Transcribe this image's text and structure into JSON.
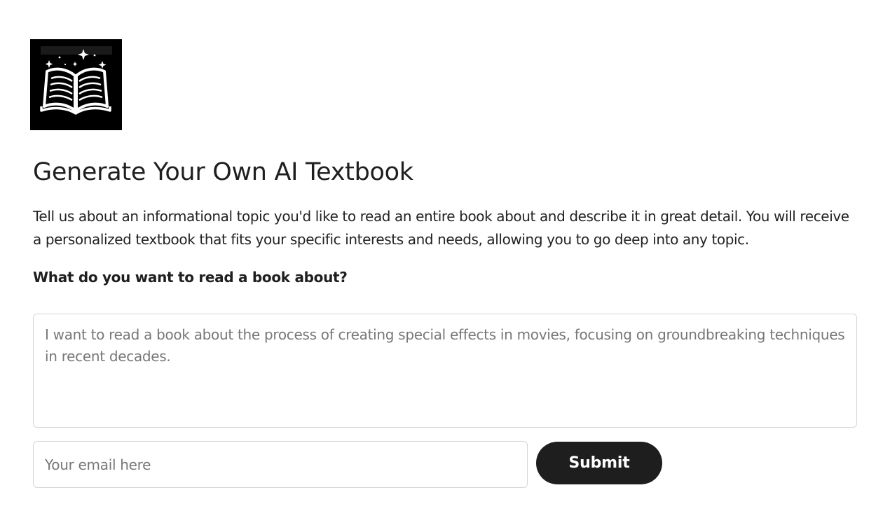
{
  "logo": {
    "icon": "open-book-with-sparkles-icon",
    "background": "#000000",
    "foreground": "#ffffff"
  },
  "page": {
    "title": "Generate Your Own AI Textbook",
    "description": "Tell us about an informational topic you'd like to read an entire book about and describe it in great detail. You will receive a personalized textbook that fits your specific interests and needs, allowing you to go deep into any topic.",
    "question": "What do you want to read a book about?"
  },
  "form": {
    "topic_placeholder": "I want to read a book about the process of creating special effects in movies, focusing on groundbreaking techniques in recent decades.",
    "topic_value": "",
    "email_placeholder": "Your email here",
    "email_value": "",
    "submit_label": "Submit",
    "submit_color": "#1e1e1e"
  }
}
